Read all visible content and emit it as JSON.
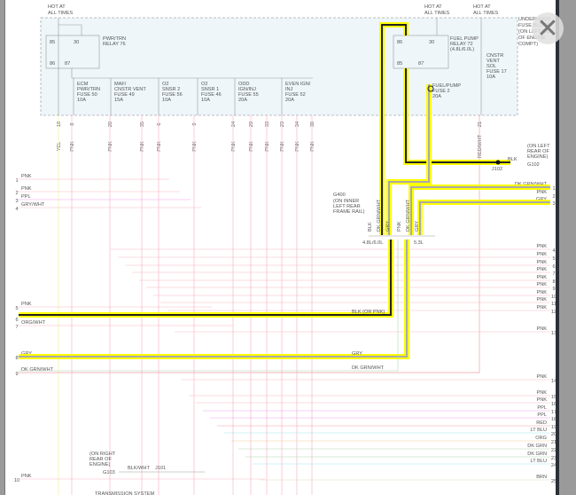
{
  "fuse_block": {
    "hot1": [
      "HOT AT",
      "ALL TIMES"
    ],
    "hot2": [
      "HOT AT",
      "ALL TIMES"
    ],
    "hot3": [
      "HOT AT",
      "ALL TIMES"
    ],
    "location": [
      "UNDERHOOD",
      "FUSE BLOCK",
      "(ON LEFT SIDE",
      "OF ENGINE",
      "COMPT)"
    ],
    "relay76": {
      "label": [
        "PWR/TRN",
        "RELAY 76"
      ],
      "pins": [
        "85",
        "30",
        "86",
        "87"
      ]
    },
    "relay72": {
      "label": [
        "FUEL PUMP",
        "RELAY 72",
        "(4.8L/6.0L)"
      ],
      "pins": [
        "86",
        "30",
        "85",
        "87"
      ]
    },
    "fuses": [
      [
        "ECM",
        "PWR/TRN",
        "FUSE 50",
        "10A"
      ],
      [
        "MAF/",
        "CNSTR VENT",
        "FUSE 49",
        "15A"
      ],
      [
        "O2",
        "SNSR 2",
        "FUSE 56",
        "10A"
      ],
      [
        "O2",
        "SNSR 1",
        "FUSE 46",
        "10A"
      ],
      [
        "ODD",
        "IGN/INJ",
        "FUSE 55",
        "20A"
      ],
      [
        "EVEN IGN/",
        "INJ",
        "FUSE 52",
        "20A"
      ],
      [
        "FUEL/PUMP",
        "FUSE 2",
        "20A"
      ],
      [
        "CNSTR",
        "VENT",
        "SOL",
        "FUSE 17",
        "10A"
      ]
    ],
    "pin_numbers": [
      "18",
      "8",
      "20",
      "35",
      "6",
      "9",
      "24",
      "29",
      "33",
      "23",
      "34",
      "30",
      "42",
      "43",
      "22",
      "21"
    ],
    "wire_colors": [
      "YEL",
      "PNK",
      "PNK",
      "PNK",
      "PNK",
      "PNK",
      "PNK",
      "PNK",
      "PNK",
      "PNK",
      "PNK",
      "PNK",
      "DK GRN/WHT",
      "BLK",
      "GRY",
      "RED/WHT"
    ]
  },
  "ground_g102": {
    "location": [
      "(ON LEFT",
      "REAR OF",
      "ENGINE)"
    ],
    "id": "G102",
    "splice": "J102",
    "wire": "BLK"
  },
  "ground_g400": {
    "id": "G400",
    "location": [
      "(ON INNER",
      "LEFT REAR",
      "FRAME RAIL)"
    ]
  },
  "ground_g103": {
    "location": [
      "(ON RIGHT",
      "REAR OF",
      "ENGINE)"
    ],
    "id": "G103",
    "wire": "BLK/WHT",
    "splice": "J101"
  },
  "connector": {
    "left_variant": "4.8L/6.0L",
    "right_variant": "5.3L",
    "left_wires": [
      "BLK",
      "DK GRN/WHT",
      "GRY"
    ],
    "right_wires": [
      "PNK",
      "DK GRN/WHT",
      "GRY"
    ]
  },
  "left_rows": [
    {
      "n": "1",
      "c": "PNK"
    },
    {
      "n": "2",
      "c": "PNK"
    },
    {
      "n": "3",
      "c": "PPL"
    },
    {
      "n": "4",
      "c": "GRY/WHT"
    },
    {
      "n": "5",
      "c": "PNK"
    },
    {
      "n": "6",
      "c": "BLK (OR PNK)"
    },
    {
      "n": "7",
      "c": "ORG/WHT"
    },
    {
      "n": "8",
      "c": "GRY"
    },
    {
      "n": "9",
      "c": "DK GRN/WHT"
    },
    {
      "n": "10",
      "c": "PNK"
    }
  ],
  "mid_labels": {
    "blk": "BLK (OR PNK)",
    "gry": "GRY",
    "dkgrn": "DK GRN/WHT"
  },
  "right_rows": [
    {
      "n": "1",
      "c": "DK GRN/WHT"
    },
    {
      "n": "2",
      "c": "PNK"
    },
    {
      "n": "3",
      "c": "GRY"
    },
    {
      "n": "4",
      "c": "PNK"
    },
    {
      "n": "5",
      "c": "PNK"
    },
    {
      "n": "6",
      "c": "PNK"
    },
    {
      "n": "7",
      "c": "PNK"
    },
    {
      "n": "8",
      "c": "PNK"
    },
    {
      "n": "9",
      "c": "PNK"
    },
    {
      "n": "10",
      "c": "PNK"
    },
    {
      "n": "11",
      "c": "PNK"
    },
    {
      "n": "12",
      "c": "PNK"
    },
    {
      "n": "13",
      "c": "PNK"
    },
    {
      "n": "14",
      "c": "PNK"
    },
    {
      "n": "15",
      "c": "PNK"
    },
    {
      "n": "16",
      "c": "PNK"
    },
    {
      "n": "17",
      "c": "PPL"
    },
    {
      "n": "18",
      "c": "PPL"
    },
    {
      "n": "19",
      "c": "RED"
    },
    {
      "n": "20",
      "c": "LT BLU"
    },
    {
      "n": "21",
      "c": "ORG"
    },
    {
      "n": "22",
      "c": "DK GRN"
    },
    {
      "n": "23",
      "c": "DK GRN"
    },
    {
      "n": "24",
      "c": "LT BLU"
    },
    {
      "n": "25",
      "c": "BRN"
    }
  ],
  "bottom_label": "TRANSMISSION SYSTEM",
  "colors": {
    "highlight": "#ffff00",
    "pink": "#f7b8c4",
    "black": "#111111",
    "gray": "#9a9a9a",
    "fuse_block_bg": "#eef6fa"
  },
  "close_icon": "close-icon"
}
